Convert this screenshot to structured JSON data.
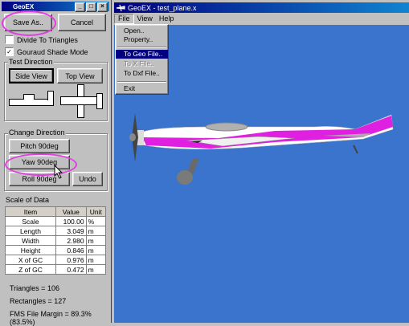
{
  "panel": {
    "title": "GeoEX",
    "save_as_label": "Save As..",
    "cancel_label": "Cancel",
    "divide_label": "Divide To Triangles",
    "divide_checked": false,
    "gouraud_label": "Gouraud Shade Mode",
    "gouraud_checked": true,
    "test_direction": {
      "title": "Test Direction",
      "side_view_label": "Side View",
      "top_view_label": "Top View"
    },
    "change_direction": {
      "title": "Change Direction",
      "pitch_label": "Pitch 90deg",
      "yaw_label": "Yaw 90deg",
      "roll_label": "Roll 90deg",
      "undo_label": "Undo"
    },
    "scale_title": "Scale of Data",
    "table": {
      "headers": [
        "Item",
        "Value",
        "Unit"
      ],
      "rows": [
        [
          "Scale",
          "100.00",
          "%"
        ],
        [
          "Length",
          "3.049",
          "m"
        ],
        [
          "Width",
          "2.980",
          "m"
        ],
        [
          "Height",
          "0.846",
          "m"
        ],
        [
          "X of GC",
          "0.976",
          "m"
        ],
        [
          "Z of GC",
          "0.472",
          "m"
        ]
      ]
    },
    "triangles_text": "Triangles = 106",
    "rectangles_text": "Rectangles = 127",
    "margin_text": "FMS File Margin = 89.3% (83.5%)"
  },
  "main_window": {
    "title": "GeoEX - test_plane.x",
    "menus": [
      "File",
      "View",
      "Help"
    ],
    "file_menu": {
      "items": [
        "Open..",
        "Property..",
        "To Geo File..",
        "To X File..",
        "To Dxf File..",
        "Exit"
      ],
      "highlighted": "To Geo File..",
      "disabled": [
        "To X File.."
      ]
    },
    "viewport_bg": "#3a74cc"
  },
  "colors": {
    "accent": "#e040e0",
    "selection": "#000080"
  }
}
